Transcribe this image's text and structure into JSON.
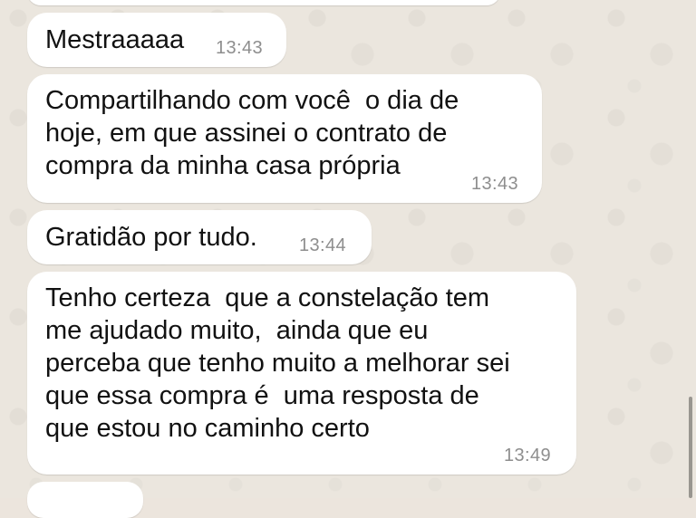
{
  "messages": [
    {
      "text": "Mestraaaaa",
      "time": "13:43"
    },
    {
      "text": "Compartilhando com você  o dia de\nhoje, em que assinei o contrato de\ncompra da minha casa própria",
      "time": "13:43"
    },
    {
      "text": "Gratidão por tudo.",
      "time": "13:44"
    },
    {
      "text": "Tenho certeza  que a constelação tem\nme ajudado muito,  ainda que eu\nperceba que tenho muito a melhorar sei\nque essa compra é  uma resposta de\nque estou no caminho certo",
      "time": "13:49"
    }
  ],
  "colors": {
    "bubble": "#ffffff",
    "background": "#ebe6de",
    "timestamp": "#8e8e8e"
  }
}
